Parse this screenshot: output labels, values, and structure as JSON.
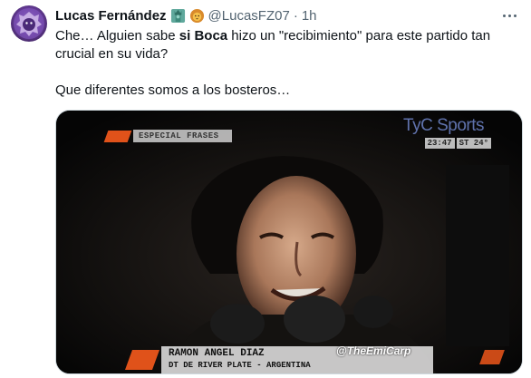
{
  "author": {
    "display_name": "Lucas Fernández",
    "handle": "@LucasFZ07",
    "separator": "·",
    "timestamp": "1h"
  },
  "tweet": {
    "line1_a": "Che… Alguien sabe ",
    "line1_bold": "si Boca",
    "line1_b": " hizo un \"recibimiento\" para este partido tan crucial en su vida?",
    "line2": "Que diferentes somos a los bosteros…"
  },
  "media": {
    "broadcaster": "TyC Sports",
    "clock_time": "23:47",
    "clock_temp": "ST 24°",
    "segment_label": "ESPECIAL FRASES",
    "person_name": "RAMON ANGEL DIAZ",
    "person_title": "DT DE RIVER PLATE - ARGENTINA",
    "watermark": "@TheEmiCarp"
  },
  "colors": {
    "text_primary": "#0f1419",
    "text_secondary": "#536471",
    "tyc_orange": "#e0521a"
  },
  "icons": {
    "verified_badge": "statue-of-liberty-emoji",
    "secondary_badge": "lion-emoji",
    "more": "ellipsis-icon"
  }
}
